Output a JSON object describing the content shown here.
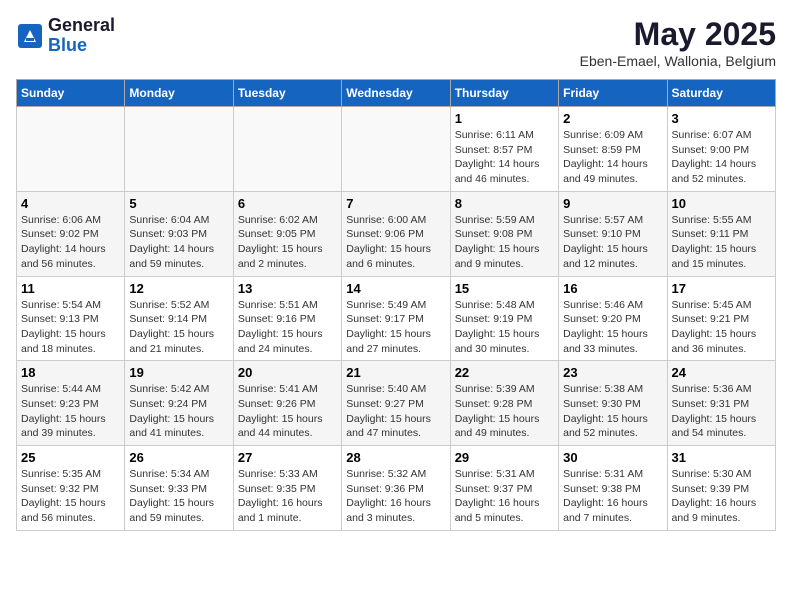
{
  "logo": {
    "general": "General",
    "blue": "Blue"
  },
  "header": {
    "month": "May 2025",
    "location": "Eben-Emael, Wallonia, Belgium"
  },
  "weekdays": [
    "Sunday",
    "Monday",
    "Tuesday",
    "Wednesday",
    "Thursday",
    "Friday",
    "Saturday"
  ],
  "weeks": [
    [
      {
        "day": "",
        "info": ""
      },
      {
        "day": "",
        "info": ""
      },
      {
        "day": "",
        "info": ""
      },
      {
        "day": "",
        "info": ""
      },
      {
        "day": "1",
        "info": "Sunrise: 6:11 AM\nSunset: 8:57 PM\nDaylight: 14 hours\nand 46 minutes."
      },
      {
        "day": "2",
        "info": "Sunrise: 6:09 AM\nSunset: 8:59 PM\nDaylight: 14 hours\nand 49 minutes."
      },
      {
        "day": "3",
        "info": "Sunrise: 6:07 AM\nSunset: 9:00 PM\nDaylight: 14 hours\nand 52 minutes."
      }
    ],
    [
      {
        "day": "4",
        "info": "Sunrise: 6:06 AM\nSunset: 9:02 PM\nDaylight: 14 hours\nand 56 minutes."
      },
      {
        "day": "5",
        "info": "Sunrise: 6:04 AM\nSunset: 9:03 PM\nDaylight: 14 hours\nand 59 minutes."
      },
      {
        "day": "6",
        "info": "Sunrise: 6:02 AM\nSunset: 9:05 PM\nDaylight: 15 hours\nand 2 minutes."
      },
      {
        "day": "7",
        "info": "Sunrise: 6:00 AM\nSunset: 9:06 PM\nDaylight: 15 hours\nand 6 minutes."
      },
      {
        "day": "8",
        "info": "Sunrise: 5:59 AM\nSunset: 9:08 PM\nDaylight: 15 hours\nand 9 minutes."
      },
      {
        "day": "9",
        "info": "Sunrise: 5:57 AM\nSunset: 9:10 PM\nDaylight: 15 hours\nand 12 minutes."
      },
      {
        "day": "10",
        "info": "Sunrise: 5:55 AM\nSunset: 9:11 PM\nDaylight: 15 hours\nand 15 minutes."
      }
    ],
    [
      {
        "day": "11",
        "info": "Sunrise: 5:54 AM\nSunset: 9:13 PM\nDaylight: 15 hours\nand 18 minutes."
      },
      {
        "day": "12",
        "info": "Sunrise: 5:52 AM\nSunset: 9:14 PM\nDaylight: 15 hours\nand 21 minutes."
      },
      {
        "day": "13",
        "info": "Sunrise: 5:51 AM\nSunset: 9:16 PM\nDaylight: 15 hours\nand 24 minutes."
      },
      {
        "day": "14",
        "info": "Sunrise: 5:49 AM\nSunset: 9:17 PM\nDaylight: 15 hours\nand 27 minutes."
      },
      {
        "day": "15",
        "info": "Sunrise: 5:48 AM\nSunset: 9:19 PM\nDaylight: 15 hours\nand 30 minutes."
      },
      {
        "day": "16",
        "info": "Sunrise: 5:46 AM\nSunset: 9:20 PM\nDaylight: 15 hours\nand 33 minutes."
      },
      {
        "day": "17",
        "info": "Sunrise: 5:45 AM\nSunset: 9:21 PM\nDaylight: 15 hours\nand 36 minutes."
      }
    ],
    [
      {
        "day": "18",
        "info": "Sunrise: 5:44 AM\nSunset: 9:23 PM\nDaylight: 15 hours\nand 39 minutes."
      },
      {
        "day": "19",
        "info": "Sunrise: 5:42 AM\nSunset: 9:24 PM\nDaylight: 15 hours\nand 41 minutes."
      },
      {
        "day": "20",
        "info": "Sunrise: 5:41 AM\nSunset: 9:26 PM\nDaylight: 15 hours\nand 44 minutes."
      },
      {
        "day": "21",
        "info": "Sunrise: 5:40 AM\nSunset: 9:27 PM\nDaylight: 15 hours\nand 47 minutes."
      },
      {
        "day": "22",
        "info": "Sunrise: 5:39 AM\nSunset: 9:28 PM\nDaylight: 15 hours\nand 49 minutes."
      },
      {
        "day": "23",
        "info": "Sunrise: 5:38 AM\nSunset: 9:30 PM\nDaylight: 15 hours\nand 52 minutes."
      },
      {
        "day": "24",
        "info": "Sunrise: 5:36 AM\nSunset: 9:31 PM\nDaylight: 15 hours\nand 54 minutes."
      }
    ],
    [
      {
        "day": "25",
        "info": "Sunrise: 5:35 AM\nSunset: 9:32 PM\nDaylight: 15 hours\nand 56 minutes."
      },
      {
        "day": "26",
        "info": "Sunrise: 5:34 AM\nSunset: 9:33 PM\nDaylight: 15 hours\nand 59 minutes."
      },
      {
        "day": "27",
        "info": "Sunrise: 5:33 AM\nSunset: 9:35 PM\nDaylight: 16 hours\nand 1 minute."
      },
      {
        "day": "28",
        "info": "Sunrise: 5:32 AM\nSunset: 9:36 PM\nDaylight: 16 hours\nand 3 minutes."
      },
      {
        "day": "29",
        "info": "Sunrise: 5:31 AM\nSunset: 9:37 PM\nDaylight: 16 hours\nand 5 minutes."
      },
      {
        "day": "30",
        "info": "Sunrise: 5:31 AM\nSunset: 9:38 PM\nDaylight: 16 hours\nand 7 minutes."
      },
      {
        "day": "31",
        "info": "Sunrise: 5:30 AM\nSunset: 9:39 PM\nDaylight: 16 hours\nand 9 minutes."
      }
    ]
  ]
}
